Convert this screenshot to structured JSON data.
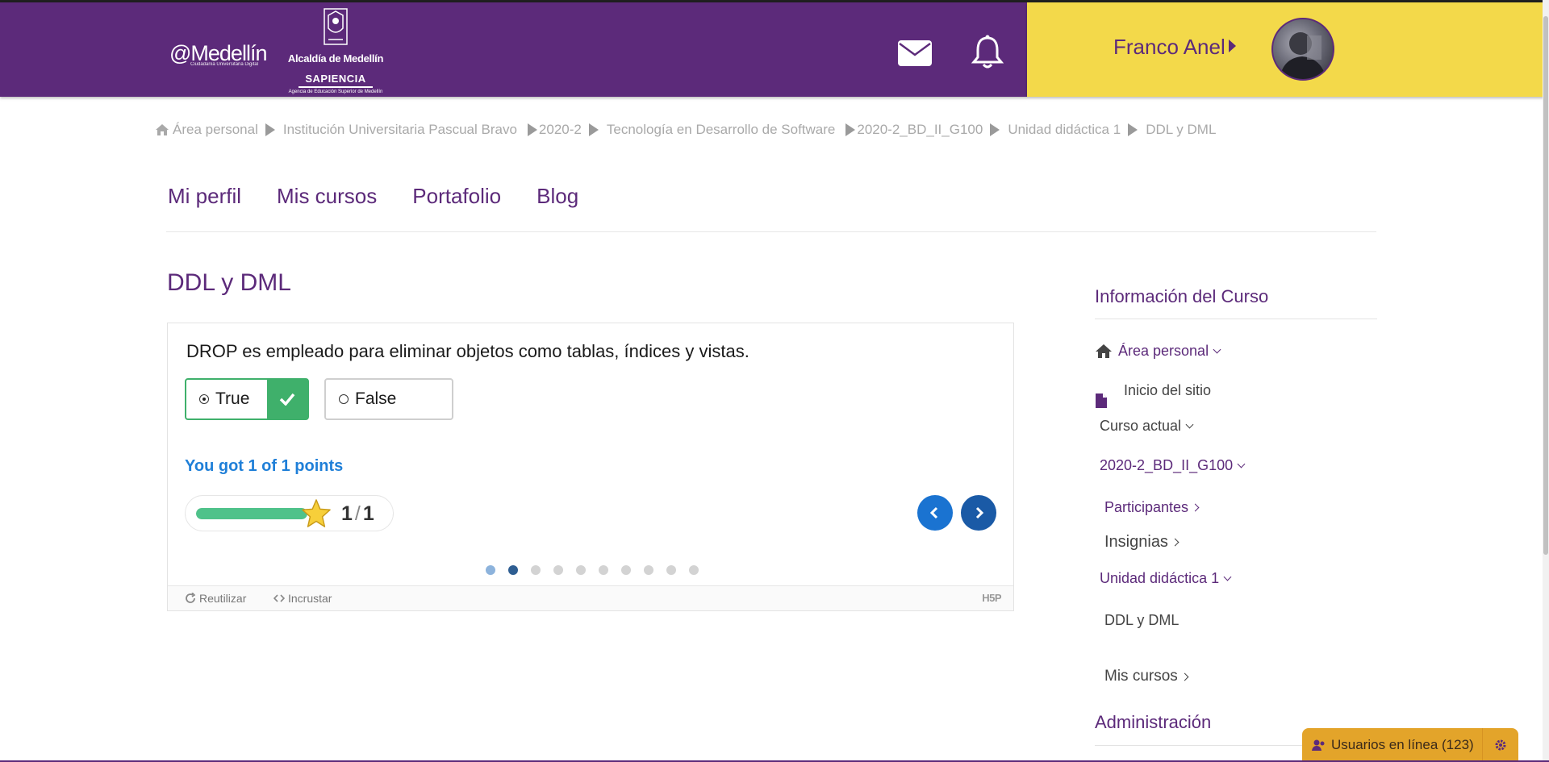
{
  "header": {
    "logo_medellin": "@Medellín",
    "logo_medellin_sub": "Ciudadanía Universitaria Digital",
    "logo_alcaldia": "Alcaldía de Medellín",
    "logo_sapiencia": "SAPIENCIA",
    "logo_agency": "Agencia de Educación Superior de Medellín",
    "icons": [
      "mail-icon",
      "bell-icon"
    ],
    "user_name": "Franco Anel",
    "colors": {
      "header_bg": "#5c2a7a",
      "user_panel_bg": "#f3d94a"
    }
  },
  "breadcrumb": [
    "Área personal",
    "Institución Universitaria Pascual Bravo",
    "2020-2",
    "Tecnología en Desarrollo de Software",
    "2020-2_BD_II_G100",
    "Unidad didáctica 1",
    "DDL y DML"
  ],
  "nav": [
    "Mi perfil",
    "Mis cursos",
    "Portafolio",
    "Blog"
  ],
  "page_title": "DDL y DML",
  "quiz": {
    "question": "DROP es empleado para eliminar objetos como tablas, índices y vistas.",
    "options": [
      {
        "label": "True",
        "selected": true,
        "correct": true
      },
      {
        "label": "False",
        "selected": false
      }
    ],
    "score_text": "You got 1 of 1 points",
    "score": {
      "value": "1",
      "slash": "/",
      "max": "1",
      "fraction": 1.0
    },
    "pages": {
      "count": 10,
      "current": 2
    },
    "footer": {
      "reuse": "Reutilizar",
      "embed": "Incrustar",
      "brand": "H5P"
    }
  },
  "sidebar": {
    "title": "Información del Curso",
    "items": [
      {
        "label": "Área personal"
      },
      {
        "label": "Inicio del sitio"
      },
      {
        "label": "Curso actual"
      },
      {
        "label": "2020-2_BD_II_G100"
      },
      {
        "label": "Participantes"
      },
      {
        "label": "Insignias"
      },
      {
        "label": "Unidad didáctica 1"
      },
      {
        "label": "DDL y DML"
      },
      {
        "label": "Mis cursos"
      }
    ],
    "admin_title": "Administración"
  },
  "online_widget": {
    "label": "Usuarios en línea (123)",
    "color": "#e3a42a"
  }
}
